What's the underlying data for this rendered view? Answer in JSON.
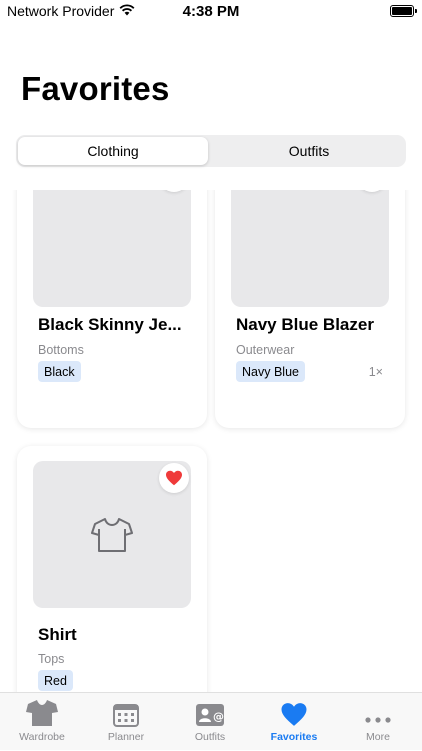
{
  "status_bar": {
    "carrier": "Network Provider",
    "time": "4:38 PM"
  },
  "page": {
    "title": "Favorites"
  },
  "segments": {
    "clothing": "Clothing",
    "outfits": "Outfits"
  },
  "items": [
    {
      "name": "Black Skinny Je...",
      "category": "Bottoms",
      "color": "Black",
      "count": ""
    },
    {
      "name": "Navy Blue Blazer",
      "category": "Outerwear",
      "color": "Navy Blue",
      "count": "1×"
    },
    {
      "name": "Shirt",
      "category": "Tops",
      "color": "Red",
      "count": ""
    }
  ],
  "tabs": [
    {
      "label": "Wardrobe",
      "icon": "tshirt-icon"
    },
    {
      "label": "Planner",
      "icon": "calendar-icon"
    },
    {
      "label": "Outfits",
      "icon": "contact-card-icon"
    },
    {
      "label": "Favorites",
      "icon": "heart-icon"
    },
    {
      "label": "More",
      "icon": "ellipsis-icon"
    }
  ],
  "colors": {
    "accent": "#1a7bf2",
    "heart": "#ef3a3a",
    "tag_bg": "#dbe8fa"
  }
}
